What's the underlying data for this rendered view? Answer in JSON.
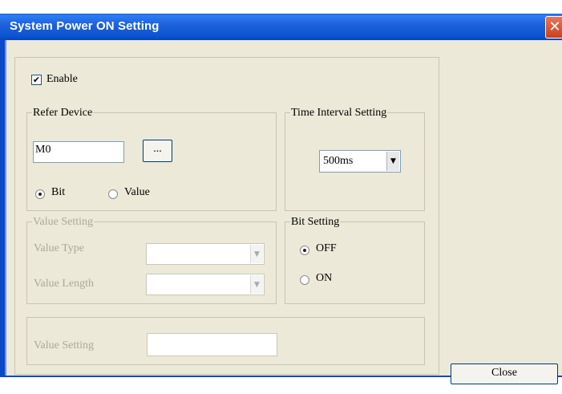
{
  "window": {
    "title": "System Power ON Setting",
    "close_glyph": "✕"
  },
  "enable": {
    "label": "Enable",
    "checked": true,
    "check_glyph": "✔"
  },
  "refer_device": {
    "group_label": "Refer Device",
    "device_value": "M0",
    "browse_label": "...",
    "radio_bit": "Bit",
    "radio_value": "Value",
    "selected": "Bit"
  },
  "time_interval": {
    "group_label": "Time Interval Setting",
    "selected": "500ms",
    "arrow_glyph": "▼"
  },
  "value_setting_group": {
    "group_label": "Value Setting",
    "value_type_label": "Value Type",
    "value_length_label": "Value Length",
    "enabled": false
  },
  "bit_setting": {
    "group_label": "Bit Setting",
    "off_label": "OFF",
    "on_label": "ON",
    "selected": "OFF"
  },
  "value_setting_panel": {
    "label": "Value Setting",
    "value": "",
    "enabled": false
  },
  "buttons": {
    "close_label": "Close"
  },
  "colors": {
    "titlebar": "#0a5ee0",
    "dialog_bg": "#ece9d8",
    "disabled_text": "#aca899"
  }
}
